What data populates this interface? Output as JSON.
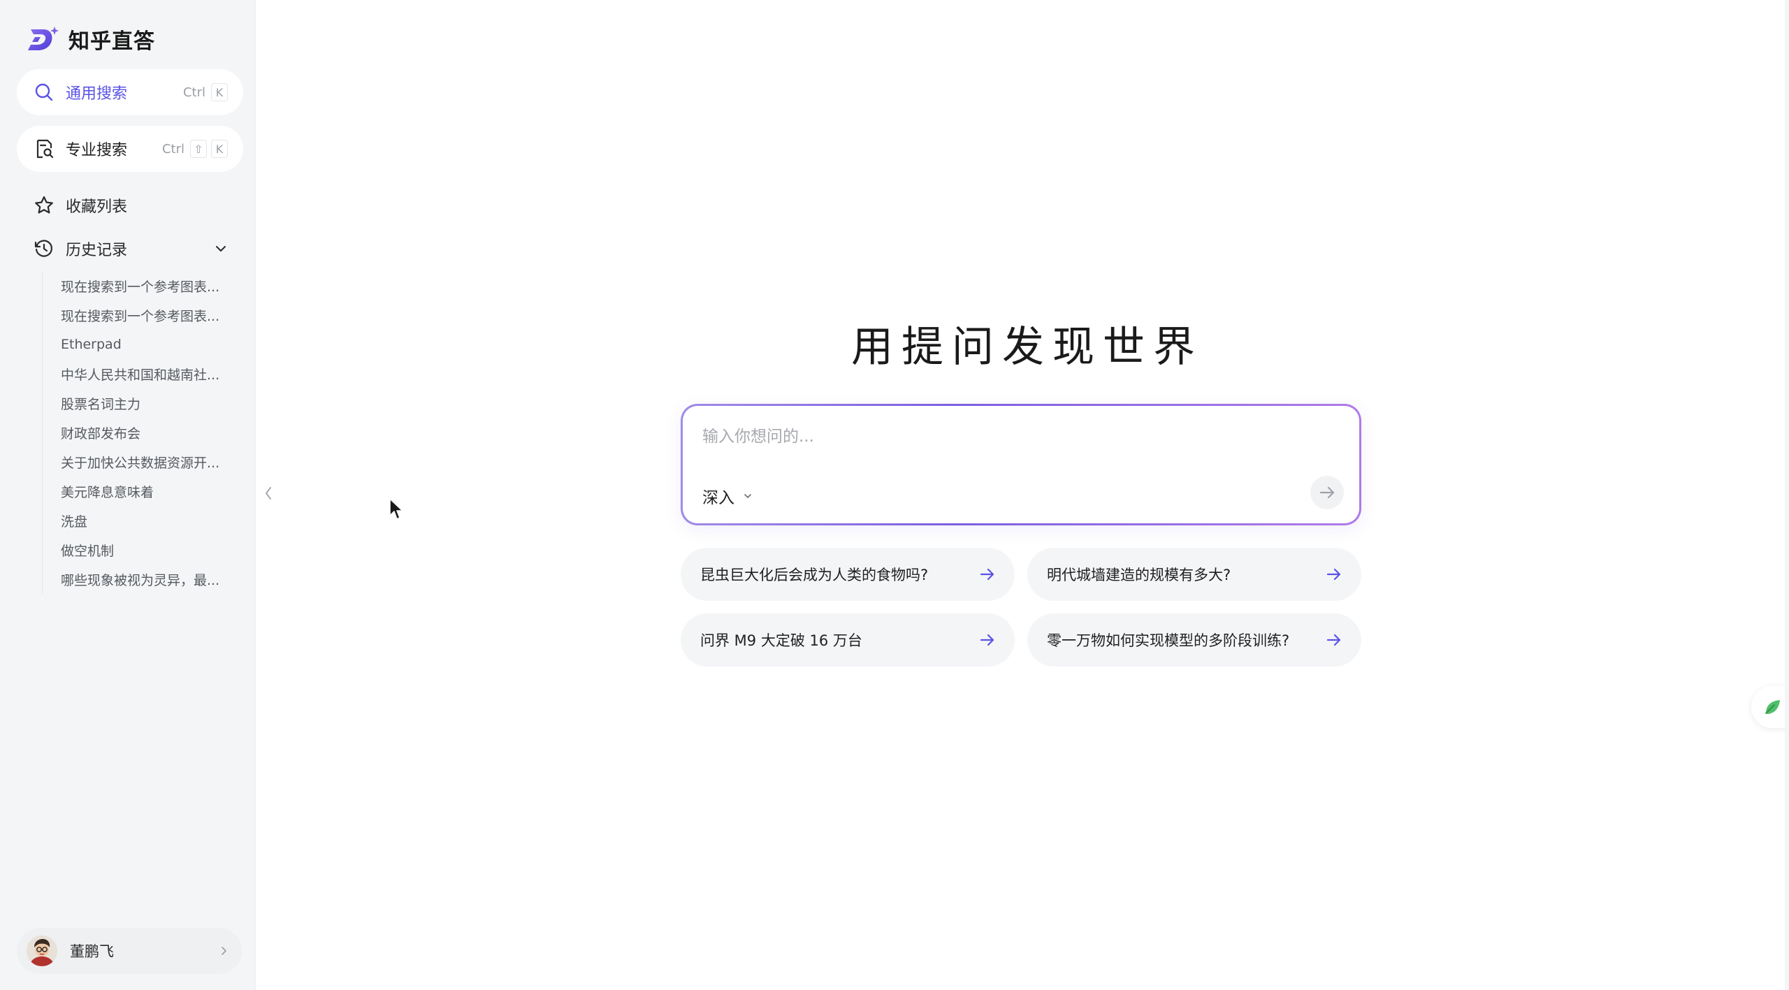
{
  "brand": {
    "name": "知乎直答",
    "accent": "#5b53e6"
  },
  "sidebar": {
    "search_general": {
      "label": "通用搜索",
      "shortcut_ctrl": "Ctrl",
      "shortcut_key": "K",
      "icon": "search-icon"
    },
    "search_pro": {
      "label": "专业搜索",
      "shortcut_ctrl": "Ctrl",
      "shortcut_shift": "⇧",
      "shortcut_key": "K",
      "icon": "doc-search-icon"
    },
    "favorites": {
      "label": "收藏列表",
      "icon": "star-icon"
    },
    "history": {
      "label": "历史记录",
      "icon": "clock-icon",
      "items": [
        "现在搜索到一个参考图表...",
        "现在搜索到一个参考图表...",
        "Etherpad",
        "中华人民共和国和越南社...",
        "股票名词主力",
        "财政部发布会",
        "关于加快公共数据资源开...",
        "美元降息意味着",
        "洗盘",
        "做空机制",
        "哪些现象被视为灵异，最..."
      ]
    },
    "user": {
      "name": "董鹏飞"
    }
  },
  "main": {
    "title": "用提问发现世界",
    "input_placeholder": "输入你想问的...",
    "mode_label": "深入",
    "suggestions": [
      "昆虫巨大化后会成为人类的食物吗?",
      "明代城墙建造的规模有多大?",
      "问界 M9 大定破 16 万台",
      "零一万物如何实现模型的多阶段训练?"
    ]
  }
}
